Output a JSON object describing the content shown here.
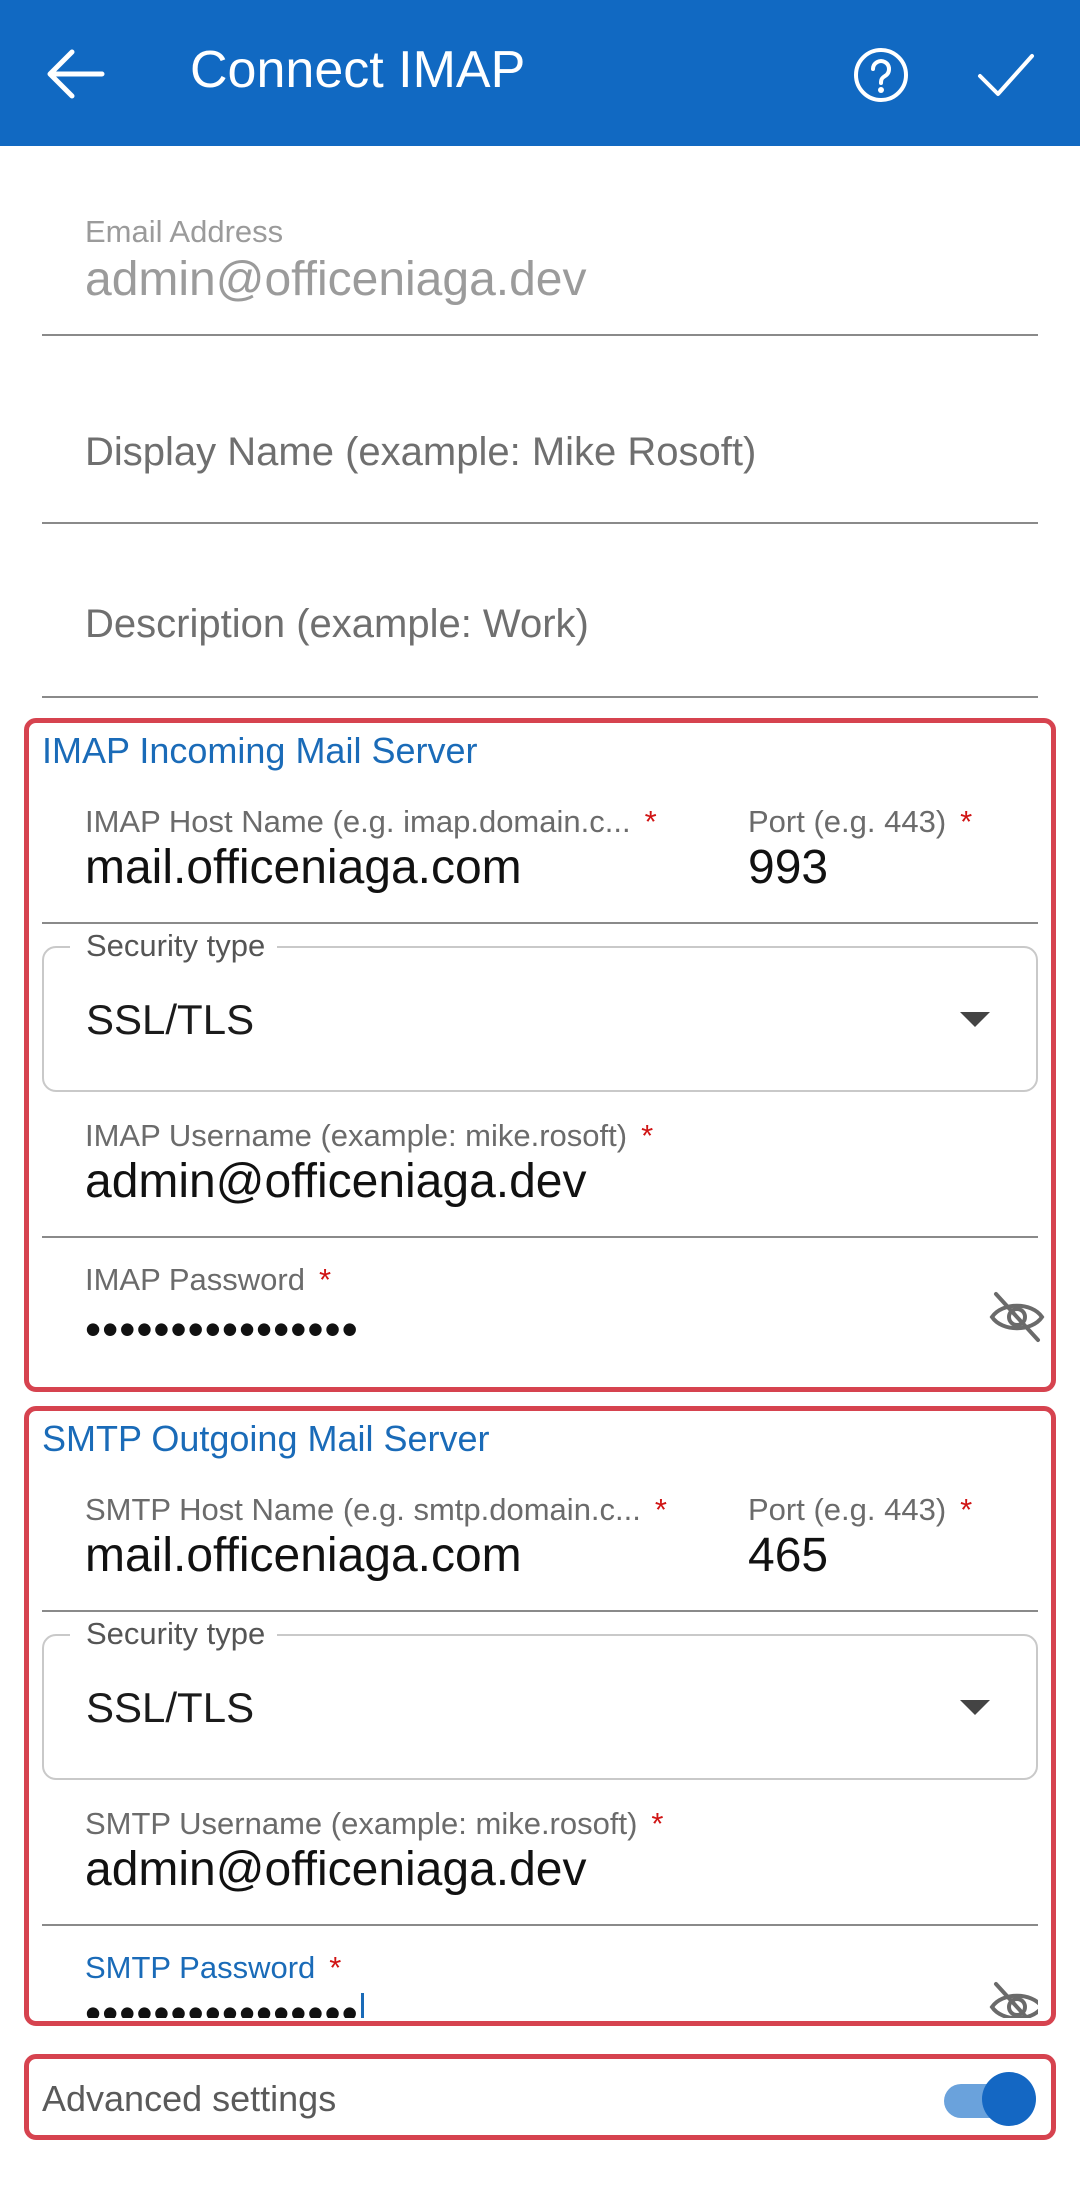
{
  "appbar": {
    "title": "Connect IMAP",
    "back_icon": "arrow-left-icon",
    "help_icon": "help-circle-icon",
    "save_icon": "check-icon",
    "color": "#1169c2"
  },
  "email": {
    "label": "Email Address",
    "value": "admin@officeniaga.dev"
  },
  "display_name": {
    "placeholder": "Display Name (example: Mike Rosoft)"
  },
  "description": {
    "placeholder": "Description (example: Work)"
  },
  "imap": {
    "section_title": "IMAP Incoming Mail Server",
    "host_label": "IMAP Host Name (e.g. imap.domain.c...",
    "host_value": "mail.officeniaga.com",
    "port_label": "Port (e.g. 443)",
    "port_value": "993",
    "security_label": "Security type",
    "security_value": "SSL/TLS",
    "username_label": "IMAP Username (example: mike.rosoft)",
    "username_value": "admin@officeniaga.dev",
    "password_label": "IMAP Password",
    "password_value": "••••••••••••••••"
  },
  "smtp": {
    "section_title": "SMTP Outgoing Mail Server",
    "host_label": "SMTP Host Name (e.g. smtp.domain.c...",
    "host_value": "mail.officeniaga.com",
    "port_label": "Port (e.g. 443)",
    "port_value": "465",
    "security_label": "Security type",
    "security_value": "SSL/TLS",
    "username_label": "SMTP Username (example: mike.rosoft)",
    "username_value": "admin@officeniaga.dev",
    "password_label": "SMTP Password",
    "password_value": "••••••••••••••••"
  },
  "advanced": {
    "label": "Advanced settings",
    "enabled": true
  },
  "required_marker": "*",
  "colors": {
    "accent": "#1a6bb8",
    "required": "#d01414",
    "highlight_box": "#d6434f"
  }
}
